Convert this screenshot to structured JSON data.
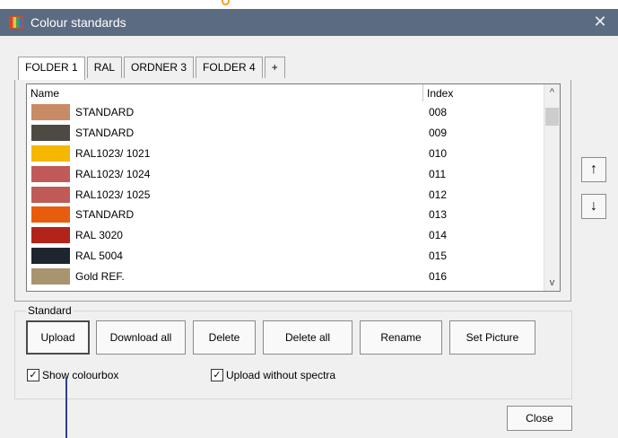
{
  "window": {
    "title": "Colour standards",
    "close_glyph": "✕",
    "app_icon": "palette-icon"
  },
  "tabs": [
    {
      "label": "FOLDER 1",
      "active": true
    },
    {
      "label": "RAL",
      "active": false
    },
    {
      "label": "ORDNER 3",
      "active": false
    },
    {
      "label": "FOLDER 4",
      "active": false
    },
    {
      "label": "+",
      "active": false
    }
  ],
  "list": {
    "columns": {
      "name": "Name",
      "index": "Index"
    },
    "rows": [
      {
        "color": "#c98a66",
        "name": "STANDARD",
        "index": "008"
      },
      {
        "color": "#4d4a44",
        "name": "STANDARD",
        "index": "009"
      },
      {
        "color": "#f5b700",
        "name": "RAL1023/ 1021",
        "index": "010"
      },
      {
        "color": "#c05a59",
        "name": "RAL1023/ 1024",
        "index": "011"
      },
      {
        "color": "#c05a59",
        "name": "RAL1023/ 1025",
        "index": "012"
      },
      {
        "color": "#e85d0d",
        "name": "STANDARD",
        "index": "013"
      },
      {
        "color": "#b2231a",
        "name": "RAL 3020",
        "index": "014"
      },
      {
        "color": "#1f252f",
        "name": "RAL 5004",
        "index": "015"
      },
      {
        "color": "#a8956f",
        "name": "Gold REF.",
        "index": "016"
      }
    ],
    "scroll_up_glyph": "^",
    "scroll_down_glyph": "v"
  },
  "side_buttons": {
    "move_up_glyph": "↑",
    "move_down_glyph": "↓"
  },
  "group": {
    "label": "Standard",
    "buttons": {
      "upload": "Upload",
      "download_all": "Download all",
      "delete": "Delete",
      "delete_all": "Delete all",
      "rename": "Rename",
      "set_picture": "Set Picture"
    },
    "checkboxes": {
      "show_colourbox": {
        "label": "Show colourbox",
        "checked": true
      },
      "upload_without_spectra": {
        "label": "Upload without spectra",
        "checked": true
      }
    }
  },
  "footer": {
    "close": "Close"
  },
  "check_glyph": "✓"
}
